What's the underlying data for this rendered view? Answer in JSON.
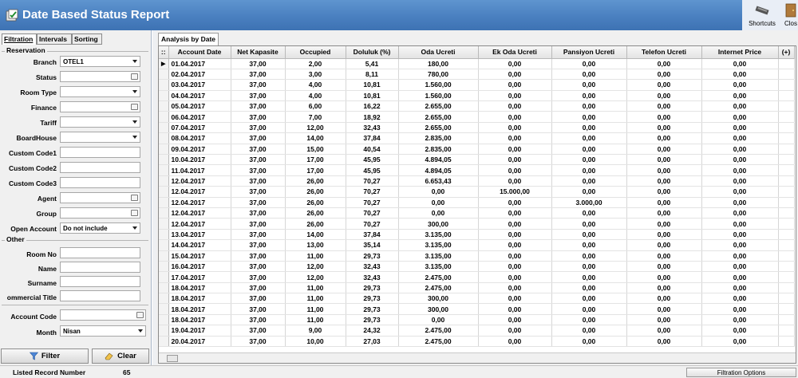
{
  "window": {
    "title": "Date Based Status Report"
  },
  "toolbar": {
    "shortcuts_label": "Shortcuts",
    "close_label": "Clos"
  },
  "left_tabs": [
    "Filtration",
    "Intervals",
    "Sorting"
  ],
  "filters": {
    "reservation_group": "Reservation",
    "branch": {
      "label": "Branch",
      "value": "OTEL1"
    },
    "status": {
      "label": "Status",
      "value": ""
    },
    "room_type": {
      "label": "Room Type",
      "value": ""
    },
    "finance": {
      "label": "Finance",
      "value": ""
    },
    "tariff": {
      "label": "Tariff",
      "value": ""
    },
    "boardhouse": {
      "label": "BoardHouse",
      "value": ""
    },
    "custom1": {
      "label": "Custom Code1",
      "value": ""
    },
    "custom2": {
      "label": "Custom Code2",
      "value": ""
    },
    "custom3": {
      "label": "Custom Code3",
      "value": ""
    },
    "agent": {
      "label": "Agent",
      "value": ""
    },
    "group": {
      "label": "Group",
      "value": ""
    },
    "open_account": {
      "label": "Open Account",
      "value": "Do not include"
    },
    "other_group": "Other",
    "room_no": {
      "label": "Room No",
      "value": ""
    },
    "name": {
      "label": "Name",
      "value": ""
    },
    "surname": {
      "label": "Surname",
      "value": ""
    },
    "commercial_title": {
      "label": "ommercial Title",
      "value": ""
    },
    "account_code": {
      "label": "Account Code",
      "value": ""
    },
    "month": {
      "label": "Month",
      "value": "Nisan"
    }
  },
  "buttons": {
    "filter": "Filter",
    "clear": "Clear"
  },
  "status": {
    "listed_label": "Listed Record Number",
    "listed_value": "65",
    "filtration_options": "Filtration Options"
  },
  "analysis_tab": "Analysis by Date",
  "table": {
    "corner": "::",
    "columns": [
      "Account Date",
      "Net Kapasite",
      "Occupied",
      "Doluluk (%)",
      "Oda Ucreti",
      "Ek Oda Ucreti",
      "Pansiyon Ucreti",
      "Telefon Ucreti",
      "Internet Price",
      "(+)"
    ],
    "rows": [
      [
        "01.04.2017",
        "37,00",
        "2,00",
        "5,41",
        "180,00",
        "0,00",
        "0,00",
        "0,00",
        "0,00"
      ],
      [
        "02.04.2017",
        "37,00",
        "3,00",
        "8,11",
        "780,00",
        "0,00",
        "0,00",
        "0,00",
        "0,00"
      ],
      [
        "03.04.2017",
        "37,00",
        "4,00",
        "10,81",
        "1.560,00",
        "0,00",
        "0,00",
        "0,00",
        "0,00"
      ],
      [
        "04.04.2017",
        "37,00",
        "4,00",
        "10,81",
        "1.560,00",
        "0,00",
        "0,00",
        "0,00",
        "0,00"
      ],
      [
        "05.04.2017",
        "37,00",
        "6,00",
        "16,22",
        "2.655,00",
        "0,00",
        "0,00",
        "0,00",
        "0,00"
      ],
      [
        "06.04.2017",
        "37,00",
        "7,00",
        "18,92",
        "2.655,00",
        "0,00",
        "0,00",
        "0,00",
        "0,00"
      ],
      [
        "07.04.2017",
        "37,00",
        "12,00",
        "32,43",
        "2.655,00",
        "0,00",
        "0,00",
        "0,00",
        "0,00"
      ],
      [
        "08.04.2017",
        "37,00",
        "14,00",
        "37,84",
        "2.835,00",
        "0,00",
        "0,00",
        "0,00",
        "0,00"
      ],
      [
        "09.04.2017",
        "37,00",
        "15,00",
        "40,54",
        "2.835,00",
        "0,00",
        "0,00",
        "0,00",
        "0,00"
      ],
      [
        "10.04.2017",
        "37,00",
        "17,00",
        "45,95",
        "4.894,05",
        "0,00",
        "0,00",
        "0,00",
        "0,00"
      ],
      [
        "11.04.2017",
        "37,00",
        "17,00",
        "45,95",
        "4.894,05",
        "0,00",
        "0,00",
        "0,00",
        "0,00"
      ],
      [
        "12.04.2017",
        "37,00",
        "26,00",
        "70,27",
        "6.653,43",
        "0,00",
        "0,00",
        "0,00",
        "0,00"
      ],
      [
        "12.04.2017",
        "37,00",
        "26,00",
        "70,27",
        "0,00",
        "15.000,00",
        "0,00",
        "0,00",
        "0,00"
      ],
      [
        "12.04.2017",
        "37,00",
        "26,00",
        "70,27",
        "0,00",
        "0,00",
        "3.000,00",
        "0,00",
        "0,00"
      ],
      [
        "12.04.2017",
        "37,00",
        "26,00",
        "70,27",
        "0,00",
        "0,00",
        "0,00",
        "0,00",
        "0,00"
      ],
      [
        "12.04.2017",
        "37,00",
        "26,00",
        "70,27",
        "300,00",
        "0,00",
        "0,00",
        "0,00",
        "0,00"
      ],
      [
        "13.04.2017",
        "37,00",
        "14,00",
        "37,84",
        "3.135,00",
        "0,00",
        "0,00",
        "0,00",
        "0,00"
      ],
      [
        "14.04.2017",
        "37,00",
        "13,00",
        "35,14",
        "3.135,00",
        "0,00",
        "0,00",
        "0,00",
        "0,00"
      ],
      [
        "15.04.2017",
        "37,00",
        "11,00",
        "29,73",
        "3.135,00",
        "0,00",
        "0,00",
        "0,00",
        "0,00"
      ],
      [
        "16.04.2017",
        "37,00",
        "12,00",
        "32,43",
        "3.135,00",
        "0,00",
        "0,00",
        "0,00",
        "0,00"
      ],
      [
        "17.04.2017",
        "37,00",
        "12,00",
        "32,43",
        "2.475,00",
        "0,00",
        "0,00",
        "0,00",
        "0,00"
      ],
      [
        "18.04.2017",
        "37,00",
        "11,00",
        "29,73",
        "2.475,00",
        "0,00",
        "0,00",
        "0,00",
        "0,00"
      ],
      [
        "18.04.2017",
        "37,00",
        "11,00",
        "29,73",
        "300,00",
        "0,00",
        "0,00",
        "0,00",
        "0,00"
      ],
      [
        "18.04.2017",
        "37,00",
        "11,00",
        "29,73",
        "300,00",
        "0,00",
        "0,00",
        "0,00",
        "0,00"
      ],
      [
        "18.04.2017",
        "37,00",
        "11,00",
        "29,73",
        "0,00",
        "0,00",
        "0,00",
        "0,00",
        "0,00"
      ],
      [
        "19.04.2017",
        "37,00",
        "9,00",
        "24,32",
        "2.475,00",
        "0,00",
        "0,00",
        "0,00",
        "0,00"
      ],
      [
        "20.04.2017",
        "37,00",
        "10,00",
        "27,03",
        "2.475,00",
        "0,00",
        "0,00",
        "0,00",
        "0,00"
      ]
    ]
  }
}
